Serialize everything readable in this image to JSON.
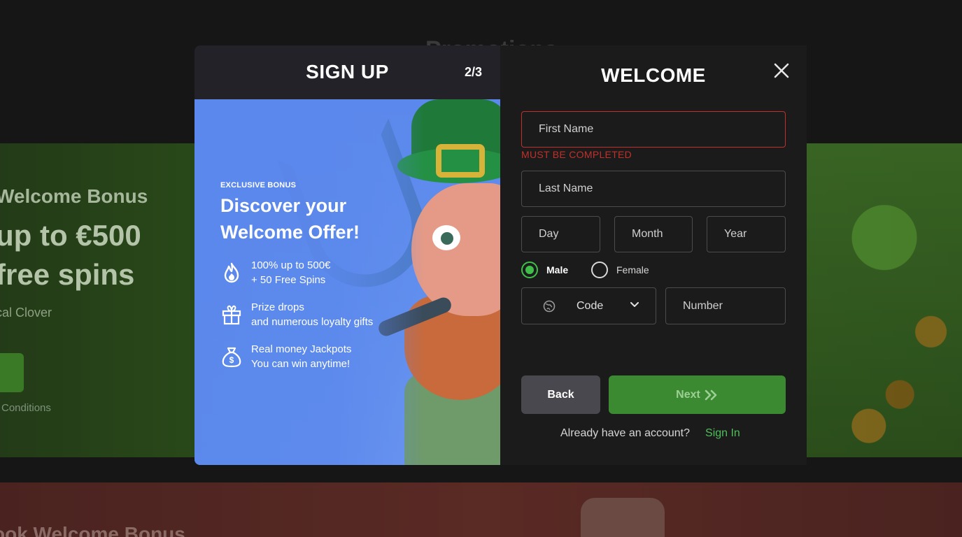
{
  "background": {
    "page_title": "Promotions",
    "promo_heading": "Welcome Bonus",
    "promo_offer": "up to €500",
    "promo_offer_line2": "free spins",
    "promo_game": "cal Clover",
    "promo_conditions": "Conditions",
    "second_promo_heading": "ook Welcome Bonus"
  },
  "promo": {
    "title": "SIGN UP",
    "step": "2/3",
    "eyebrow": "EXCLUSIVE BONUS",
    "headline_line1": "Discover your",
    "headline_line2": "Welcome Offer!",
    "features": [
      {
        "icon": "fire-icon",
        "line1": "100% up to 500€",
        "line2": "+ 50 Free Spins"
      },
      {
        "icon": "gift-icon",
        "line1": "Prize drops",
        "line2": "and numerous loyalty gifts"
      },
      {
        "icon": "money-bag-icon",
        "line1": "Real money Jackpots",
        "line2": "You can win anytime!"
      }
    ]
  },
  "form": {
    "title": "WELCOME",
    "first_name": {
      "placeholder": "First Name",
      "value": ""
    },
    "first_name_error": "MUST BE COMPLETED",
    "last_name": {
      "placeholder": "Last Name",
      "value": ""
    },
    "day": {
      "placeholder": "Day"
    },
    "month": {
      "placeholder": "Month"
    },
    "year": {
      "placeholder": "Year"
    },
    "gender": {
      "male": "Male",
      "female": "Female",
      "selected": "Male"
    },
    "phone_code": "Code",
    "phone_number": {
      "placeholder": "Number"
    },
    "back_label": "Back",
    "next_label": "Next",
    "account_prompt": "Already have an account?",
    "signin_label": "Sign In"
  },
  "colors": {
    "accent_green": "#3b8a32",
    "link_green": "#4fbf5a",
    "error_red": "#c0312b",
    "promo_blue": "#5b88ec"
  }
}
